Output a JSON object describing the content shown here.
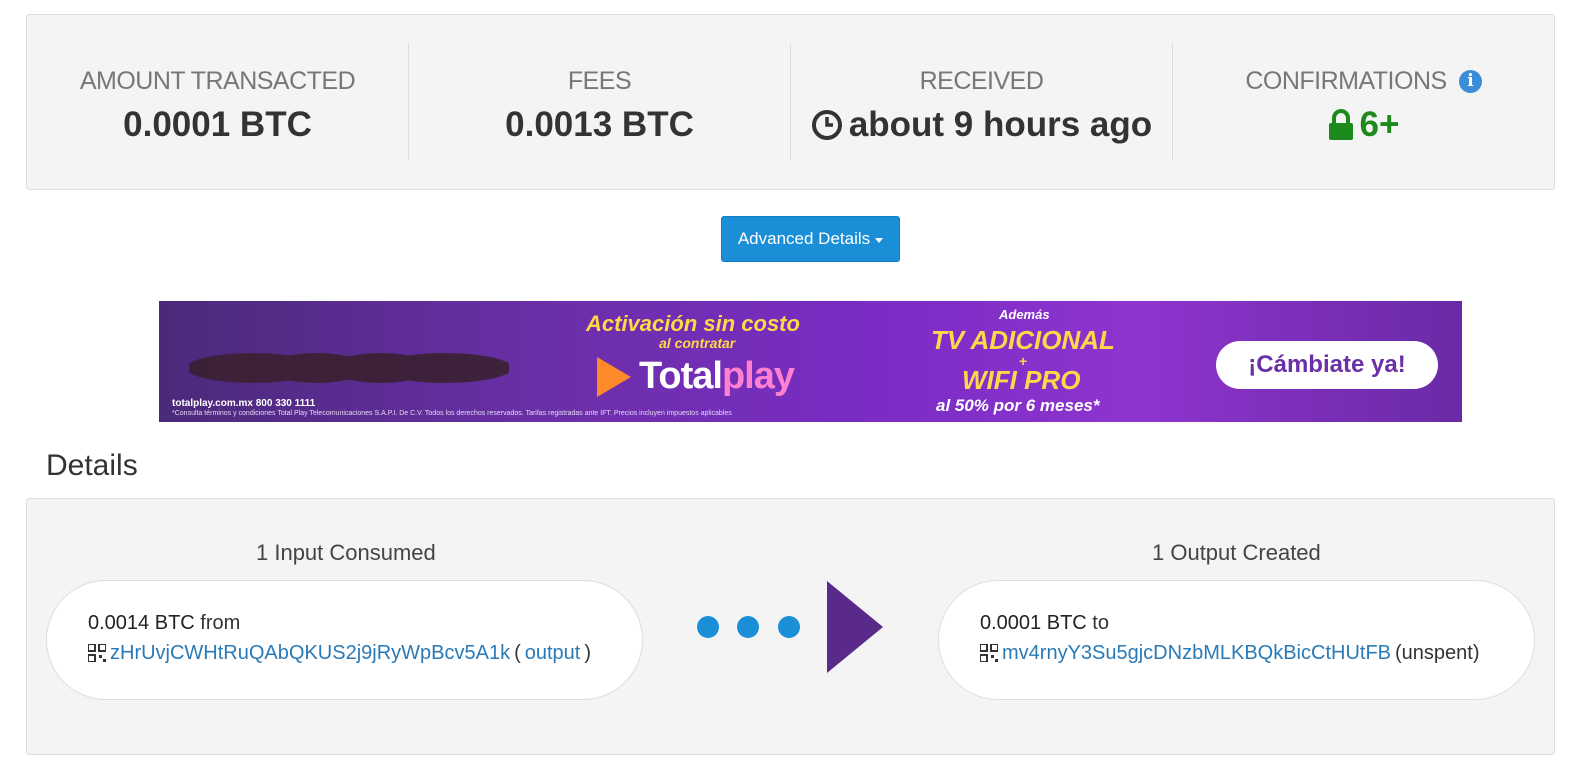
{
  "summary": {
    "amount": {
      "label": "AMOUNT TRANSACTED",
      "value": "0.0001 BTC"
    },
    "fees": {
      "label": "FEES",
      "value": "0.0013 BTC"
    },
    "received": {
      "label": "RECEIVED",
      "value": "about 9 hours ago",
      "icon": "clock-icon"
    },
    "confirmations": {
      "label": "CONFIRMATIONS",
      "value": "6+",
      "icon": "lock-icon",
      "info_icon": "info-icon",
      "color": "#1d8a1d"
    }
  },
  "advanced_button": {
    "label": "Advanced Details"
  },
  "ad": {
    "url": "totalplay.com.mx 800 330 1111",
    "fine_print": "*Consulta términos y condiciones Total Play Telecomunicaciones S.A.P.I. De C.V. Todos los derechos reservados. Tarifas registradas ante IFT. Precios incluyen impuestos aplicables",
    "headline": "Activación sin costo",
    "subheadline": "al contratar",
    "brand": "Total",
    "brand_accent": "play",
    "ademas": "Además",
    "tv": "TV ADICIONAL",
    "plus": "+",
    "wifi": "WIFI PRO",
    "discount": "al 50% por 6 meses*",
    "cta": "¡Cámbiate ya!"
  },
  "details": {
    "title": "Details",
    "inputs": {
      "title": "1 Input Consumed",
      "amount": "0.0014 BTC",
      "direction": "from",
      "address": "zHrUvjCWHtRuQAbQKUS2j9jRyWpBcv5A1k",
      "link_label": "output"
    },
    "outputs": {
      "title": "1 Output Created",
      "amount": "0.0001 BTC",
      "direction": "to",
      "address": "mv4rnyY3Su5gjcDNzbMLKBQkBicCtHUtFB",
      "status": "(unspent)"
    }
  },
  "colors": {
    "accent": "#1a8fd8",
    "arrow": "#5a2a8a",
    "link": "#2a7ab8"
  }
}
